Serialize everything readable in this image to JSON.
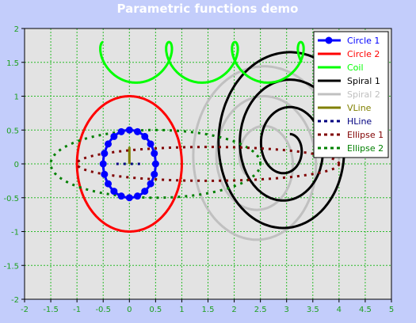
{
  "chart_data": {
    "type": "line",
    "title": "Parametric functions demo",
    "xlim": [
      -2,
      5
    ],
    "ylim": [
      -2,
      2
    ],
    "x_ticks": [
      "-2",
      "-1.5",
      "-1",
      "-0.5",
      "0",
      "0.5",
      "1",
      "1.5",
      "2",
      "2.5",
      "3",
      "3.5",
      "4",
      "4.5",
      "5"
    ],
    "y_ticks": [
      "2",
      "1.5",
      "1",
      "0.5",
      "0",
      "-0.5",
      "-1",
      "-1.5",
      "-2"
    ],
    "grid": true,
    "grid_color": "#2bbb2b",
    "plot_background": "#e3e3e3",
    "page_background": "#c3cdfb",
    "tick_label_color": "#1ea01e",
    "legend_position": "top-right",
    "series": [
      {
        "name": "Circle 1",
        "color": "#0000ff",
        "style": "solid",
        "marker": "circle",
        "parametric": "x = 0.5 cos t, y = 0.5 sin t",
        "points": 20
      },
      {
        "name": "Circle 2",
        "color": "#ff0000",
        "style": "solid",
        "parametric": "x = cos t, y = sin t"
      },
      {
        "name": "Coil",
        "color": "#00ff00",
        "style": "solid",
        "parametric": "x = 0.2 t - 0.3 sin t, y = 1.5 + 0.3 cos t, t in [0, 6.5 pi]"
      },
      {
        "name": "Spiral 1",
        "color": "#000000",
        "style": "solid",
        "parametric": "center (3, 0.25), r from 1.5 to 0.2"
      },
      {
        "name": "Spiral 2",
        "color": "#c0c0c0",
        "style": "solid",
        "parametric": "center (2.5, 0.05), r from 1.5 to 0.35"
      },
      {
        "name": "VLine",
        "color": "#808000",
        "style": "solid",
        "parametric": "x = 0, y from 0 to 0.25"
      },
      {
        "name": "HLine",
        "color": "#000080",
        "style": "dashed",
        "parametric": "x from -0.25 to 0.25, y = 0"
      },
      {
        "name": "Ellipse 1",
        "color": "#800000",
        "style": "dashed",
        "parametric": "x = 1.5 + 2.5 cos t, y = 0.25 sin t"
      },
      {
        "name": "Ellipse 2",
        "color": "#008000",
        "style": "dashed",
        "parametric": "x = 0.5 + 2 cos t, y = 0.5 sin t"
      }
    ]
  }
}
